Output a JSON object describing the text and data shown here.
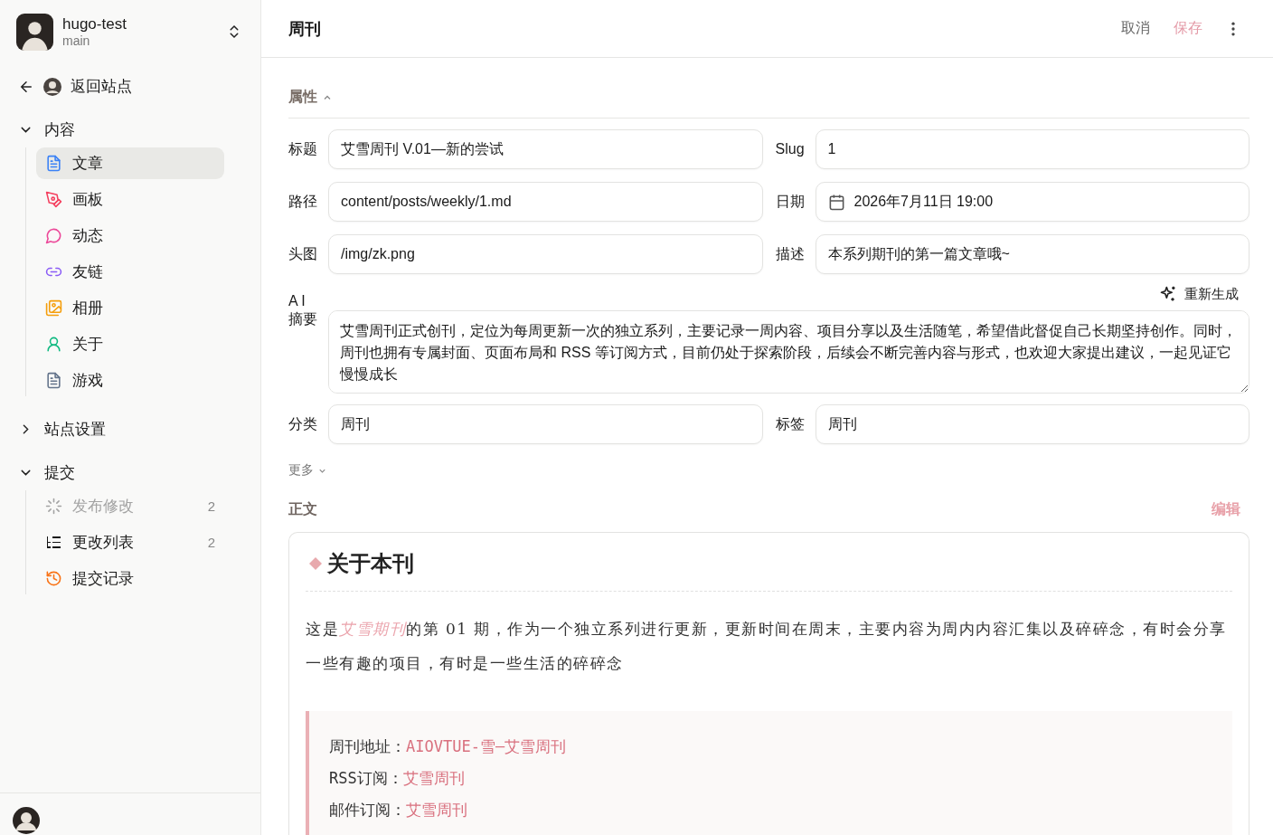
{
  "site": {
    "name": "hugo-test",
    "branch": "main"
  },
  "back": {
    "label": "返回站点"
  },
  "nav": [
    {
      "label": "内容",
      "expanded": true,
      "children": [
        {
          "label": "文章",
          "kind": "doc",
          "color": "#3b82f6",
          "selected": true
        },
        {
          "label": "画板",
          "kind": "pen",
          "color": "#f43f5e",
          "selected": false
        },
        {
          "label": "动态",
          "kind": "chat",
          "color": "#ec4899",
          "selected": false
        },
        {
          "label": "友链",
          "kind": "link",
          "color": "#8b5cf6",
          "selected": false
        },
        {
          "label": "相册",
          "kind": "gallery",
          "color": "#f59e0b",
          "selected": false
        },
        {
          "label": "关于",
          "kind": "person",
          "color": "#10b981",
          "selected": false
        },
        {
          "label": "游戏",
          "kind": "doc",
          "color": "#64748b",
          "selected": false
        }
      ]
    },
    {
      "label": "站点设置",
      "expanded": false
    },
    {
      "label": "提交",
      "expanded": true,
      "children": [
        {
          "label": "发布修改",
          "kind": "spinner",
          "color": "#a3a3a3",
          "count": "2",
          "disabled": true,
          "selected": false
        },
        {
          "label": "更改列表",
          "kind": "list",
          "color": "#171717",
          "count": "2",
          "disabled": false,
          "selected": false
        },
        {
          "label": "提交记录",
          "kind": "history",
          "color": "#f97316",
          "disabled": false,
          "selected": false
        }
      ]
    }
  ],
  "header": {
    "title": "周刊",
    "cancel": "取消",
    "save": {
      "label": "保存",
      "disabled": true
    }
  },
  "properties": {
    "title": "属性",
    "expanded": true,
    "fields": [
      {
        "label": "标题",
        "value": "艾雪周刊 V.01—新的尝试",
        "kind": "text"
      },
      {
        "label": "Slug",
        "value": "1",
        "kind": "text"
      },
      {
        "label": "路径",
        "value": "content/posts/weekly/1.md",
        "kind": "text"
      },
      {
        "label": "日期",
        "value": "2026年7月11日 19:00",
        "kind": "date"
      },
      {
        "label": "头图",
        "value": "/img/zk.png",
        "kind": "text"
      },
      {
        "label": "描述",
        "value": "本系列期刊的第一篇文章哦~",
        "kind": "text"
      }
    ],
    "summary": {
      "label": "A I\n摘要",
      "action": "重新生成",
      "value": "艾雪周刊正式创刊，定位为每周更新一次的独立系列，主要记录一周内容、项目分享以及生活随笔，希望借此督促自己长期坚持创作。同时，周刊也拥有专属封面、页面布局和 RSS 等订阅方式，目前仍处于探索阶段，后续会不断完善内容与形式，也欢迎大家提出建议，一起见证它慢慢成长"
    },
    "fields2": [
      {
        "label": "分类",
        "value": "周刊",
        "kind": "text"
      },
      {
        "label": "标签",
        "value": "周刊",
        "kind": "text"
      }
    ],
    "more": {
      "label": "更多",
      "expanded": false
    }
  },
  "body": {
    "title": "正文",
    "edit": "编辑",
    "heading": "关于本刊",
    "paragraph": [
      {
        "text": "这是",
        "emphasis": false
      },
      {
        "text": "艾雪期刊",
        "emphasis": true
      },
      {
        "text": "的第 01 期，作为一个独立系列进行更新，更新时间在周末，主要内容为周内内容汇集以及碎碎念，有时会分享一些有趣的项目，有时是一些生活的碎碎念",
        "emphasis": false
      }
    ],
    "quote": [
      {
        "label": "周刊地址：",
        "link": "AIOVTUE-雪—艾雪周刊"
      },
      {
        "label": "RSS订阅：",
        "link": "艾雪周刊"
      },
      {
        "label": "邮件订阅：",
        "link": "艾雪周刊"
      }
    ]
  }
}
